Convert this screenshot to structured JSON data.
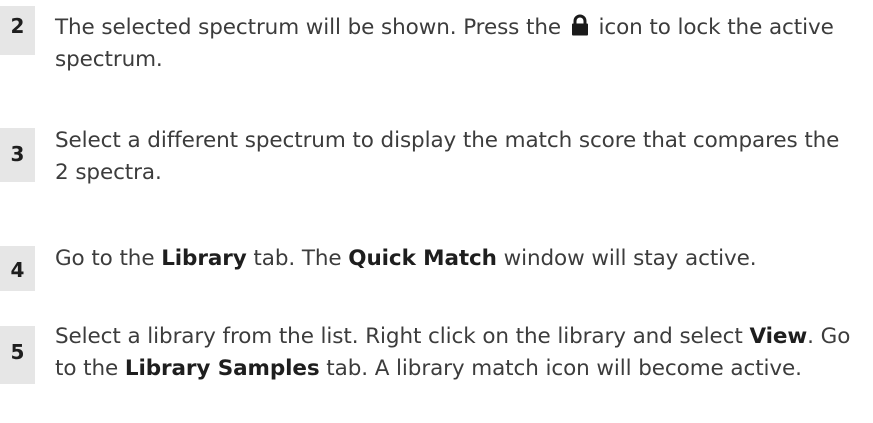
{
  "steps": [
    {
      "number": "2",
      "parts": [
        {
          "t": "The selected spectrum will be shown. Press the "
        },
        {
          "icon": "lock-icon"
        },
        {
          "t": " icon to lock the active spectrum."
        }
      ]
    },
    {
      "number": "3",
      "parts": [
        {
          "t": "Select a different spectrum to display the match score that compares the 2 spectra."
        }
      ]
    },
    {
      "number": "4",
      "parts": [
        {
          "t": "Go to the "
        },
        {
          "b": "Library"
        },
        {
          "t": " tab. The "
        },
        {
          "b": "Quick Match"
        },
        {
          "t": " window will stay active."
        }
      ]
    },
    {
      "number": "5",
      "parts": [
        {
          "t": "Select a library from the list. Right click on the library and select "
        },
        {
          "b": "View"
        },
        {
          "t": ". Go to the "
        },
        {
          "b": "Library Samples"
        },
        {
          "t": " tab. A library match icon will become active."
        }
      ]
    }
  ]
}
